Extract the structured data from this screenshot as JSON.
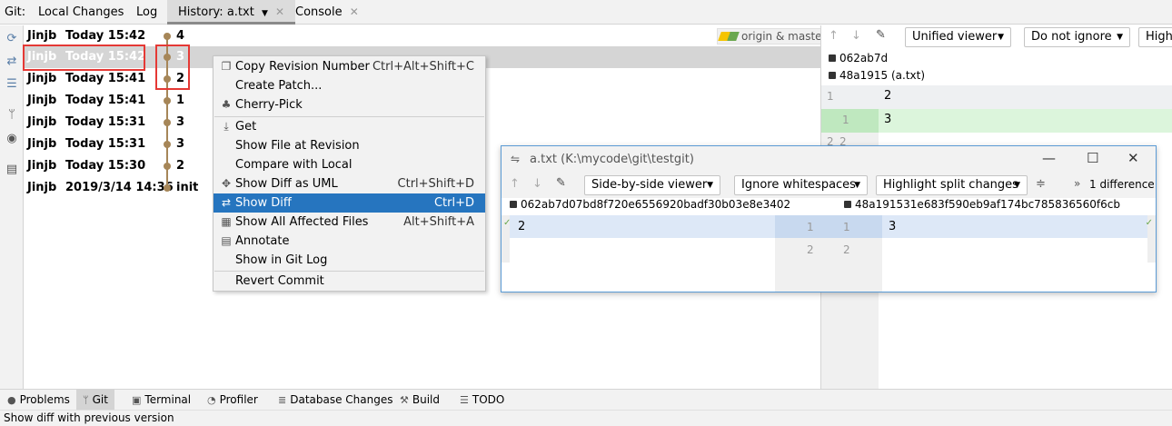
{
  "tabbar": {
    "prefix": "Git:",
    "tabs": [
      {
        "label": "Local Changes"
      },
      {
        "label": "Log"
      },
      {
        "label": "History: a.txt"
      },
      {
        "label": "Console"
      }
    ]
  },
  "log": {
    "branch_tag": "origin & master",
    "rows": [
      {
        "author": "Jinjb",
        "date": "Today 15:42",
        "message": "4"
      },
      {
        "author": "Jinjb",
        "date": "Today 15:42",
        "message": "3"
      },
      {
        "author": "Jinjb",
        "date": "Today 15:41",
        "message": "2"
      },
      {
        "author": "Jinjb",
        "date": "Today 15:41",
        "message": "1"
      },
      {
        "author": "Jinjb",
        "date": "Today 15:31",
        "message": "3"
      },
      {
        "author": "Jinjb",
        "date": "Today 15:31",
        "message": "3"
      },
      {
        "author": "Jinjb",
        "date": "Today 15:30",
        "message": "2"
      },
      {
        "author": "Jinjb",
        "date": "2019/3/14 14:36",
        "message": "init"
      }
    ]
  },
  "context_menu": {
    "items": [
      {
        "label": "Copy Revision Number",
        "shortcut": "Ctrl+Alt+Shift+C"
      },
      {
        "label": "Create Patch...",
        "shortcut": ""
      },
      {
        "label": "Cherry-Pick",
        "shortcut": ""
      },
      {
        "label": "Get",
        "shortcut": ""
      },
      {
        "label": "Show File at Revision",
        "shortcut": ""
      },
      {
        "label": "Compare with Local",
        "shortcut": ""
      },
      {
        "label": "Show Diff as UML",
        "shortcut": "Ctrl+Shift+D"
      },
      {
        "label": "Show Diff",
        "shortcut": "Ctrl+D"
      },
      {
        "label": "Show All Affected Files",
        "shortcut": "Alt+Shift+A"
      },
      {
        "label": "Annotate",
        "shortcut": ""
      },
      {
        "label": "Show in Git Log",
        "shortcut": ""
      },
      {
        "label": "Revert Commit",
        "shortcut": ""
      }
    ]
  },
  "right_panel": {
    "viewer": "Unified viewer",
    "ignore": "Do not ignore",
    "highlight": "Highl",
    "hash_left": "062ab7d",
    "hash_right": "48a1915 (a.txt)",
    "lines": [
      {
        "left": "1",
        "right": "",
        "text": "2"
      },
      {
        "left": "",
        "right": "1",
        "text": "3"
      },
      {
        "left": "2",
        "right": "2",
        "text": ""
      }
    ]
  },
  "diff_window": {
    "title": "a.txt (K:\\mycode\\git\\testgit)",
    "viewer": "Side-by-side viewer",
    "whitespace": "Ignore whitespaces",
    "highlight": "Highlight split changes",
    "differences": "1 difference",
    "hash_left": "062ab7d07bd8f720e6556920badf30b03e8e3402",
    "hash_right": "48a191531e683f590eb9af174bc785836560f6cb",
    "left_text": "2",
    "right_text": "3",
    "gutter": [
      {
        "left": "1",
        "right": "1"
      },
      {
        "left": "2",
        "right": "2"
      }
    ]
  },
  "bottom_tabs": [
    {
      "label": "Problems"
    },
    {
      "label": "Git"
    },
    {
      "label": "Terminal"
    },
    {
      "label": "Profiler"
    },
    {
      "label": "Database Changes"
    },
    {
      "label": "Build"
    },
    {
      "label": "TODO"
    }
  ],
  "status": "Show diff with previous version",
  "colors": {
    "accent": "#2675bf",
    "graph": "#a68658",
    "highlight_box": "#e53935",
    "added_bg": "#d8f5d8",
    "changed_bg": "#dde8f7"
  }
}
